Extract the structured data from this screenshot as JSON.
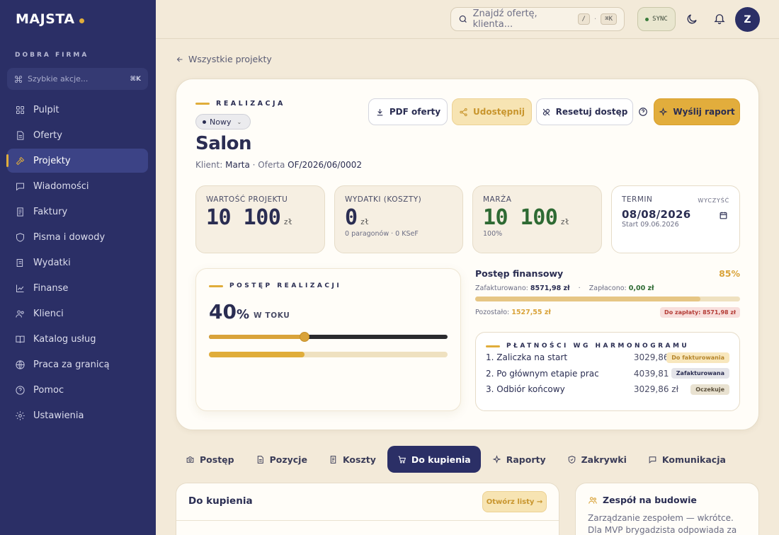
{
  "sidebar": {
    "logo": "MAJSTA",
    "company": "DOBRA FIRMA",
    "quick_actions": "Szybkie akcje...",
    "quick_kbd": "⌘K",
    "items": [
      {
        "label": "Pulpit",
        "icon": "grid-icon"
      },
      {
        "label": "Oferty",
        "icon": "document-icon"
      },
      {
        "label": "Projekty",
        "icon": "hammer-icon",
        "active": true
      },
      {
        "label": "Wiadomości",
        "icon": "chat-icon"
      },
      {
        "label": "Faktury",
        "icon": "invoice-icon"
      },
      {
        "label": "Pisma i dowody",
        "icon": "shield-icon"
      },
      {
        "label": "Wydatki",
        "icon": "wallet-icon"
      },
      {
        "label": "Finanse",
        "icon": "chart-icon"
      },
      {
        "label": "Klienci",
        "icon": "users-icon"
      },
      {
        "label": "Katalog usług",
        "icon": "book-icon"
      },
      {
        "label": "Praca za granicą",
        "icon": "globe-icon"
      },
      {
        "label": "Pomoc",
        "icon": "help-icon"
      },
      {
        "label": "Ustawienia",
        "icon": "gear-icon"
      }
    ]
  },
  "topbar": {
    "search_placeholder": "Znajdź ofertę, klienta...",
    "kbd_slash": "/",
    "kbd_sep": "·",
    "kbd_cmd": "⌘K",
    "sync": "SYNC",
    "avatar": "Z"
  },
  "back": "Wszystkie projekty",
  "project": {
    "eyebrow": "REALIZACJA",
    "status": "Nowy",
    "title": "Salon",
    "client_label": "Klient:",
    "client": "Marta",
    "offer_label": "· Oferta",
    "offer": "OF/2026/06/0002",
    "buttons": {
      "pdf": "PDF oferty",
      "share": "Udostępnij",
      "reset": "Resetuj dostęp",
      "send": "Wyślij raport"
    }
  },
  "stats": {
    "value": {
      "label": "WARTOŚĆ PROJEKTU",
      "amount": "10 100",
      "unit": "zł"
    },
    "costs": {
      "label": "WYDATKI (KOSZTY)",
      "amount": "0",
      "unit": "zł",
      "sub": "0 paragonów · 0 KSeF"
    },
    "margin": {
      "label": "MARŻA",
      "amount": "10 100",
      "unit": "zł",
      "sub": "100%"
    },
    "deadline": {
      "label": "TERMIN",
      "clear": "WYCZYŚĆ",
      "date": "08/08/2026",
      "start": "Start 09.06.2026"
    }
  },
  "progress": {
    "eyebrow": "POSTĘP REALIZACJI",
    "percent": "40",
    "percent_sign": "%",
    "status": "W TOKU",
    "fraction": 0.4
  },
  "finance": {
    "title": "Postęp finansowy",
    "percent": "85%",
    "invoiced_label": "Zafakturowano:",
    "invoiced": "8571,98 zł",
    "dot": "·",
    "paid_label": "Zapłacono:",
    "paid": "0,00 zł",
    "remaining_label": "Pozostało:",
    "remaining": "1527,55 zł",
    "due": "Do zapłaty: 8571,98 zł",
    "fraction": 0.85
  },
  "schedule": {
    "eyebrow": "PŁATNOŚCI WG HARMONOGRAMU",
    "rows": [
      {
        "name": "1. Zaliczka na start",
        "amount": "3029,86 zł",
        "tag": "Do fakturowania"
      },
      {
        "name": "2. Po głównym etapie prac",
        "amount": "4039,81 zł",
        "tag": "Zafakturowana"
      },
      {
        "name": "3. Odbiór końcowy",
        "amount": "3029,86 zł",
        "tag": "Oczekuje"
      }
    ]
  },
  "tabs": [
    "Postęp",
    "Pozycje",
    "Koszty",
    "Do kupienia",
    "Raporty",
    "Zakrywki",
    "Komunikacja"
  ],
  "panel_buy": {
    "title": "Do kupienia",
    "open": "Otwórz listy →"
  },
  "panel_team": {
    "title": "Zespół na budowie",
    "text": "Zarządzanie zespołem — wkrótce. Dla MVP brygadzista odpowiada za zlecenie."
  },
  "colors": {
    "accent": "#e0ad3b",
    "navy": "#2b2f66",
    "green": "#2e6a33",
    "background": "#f3ead9"
  }
}
